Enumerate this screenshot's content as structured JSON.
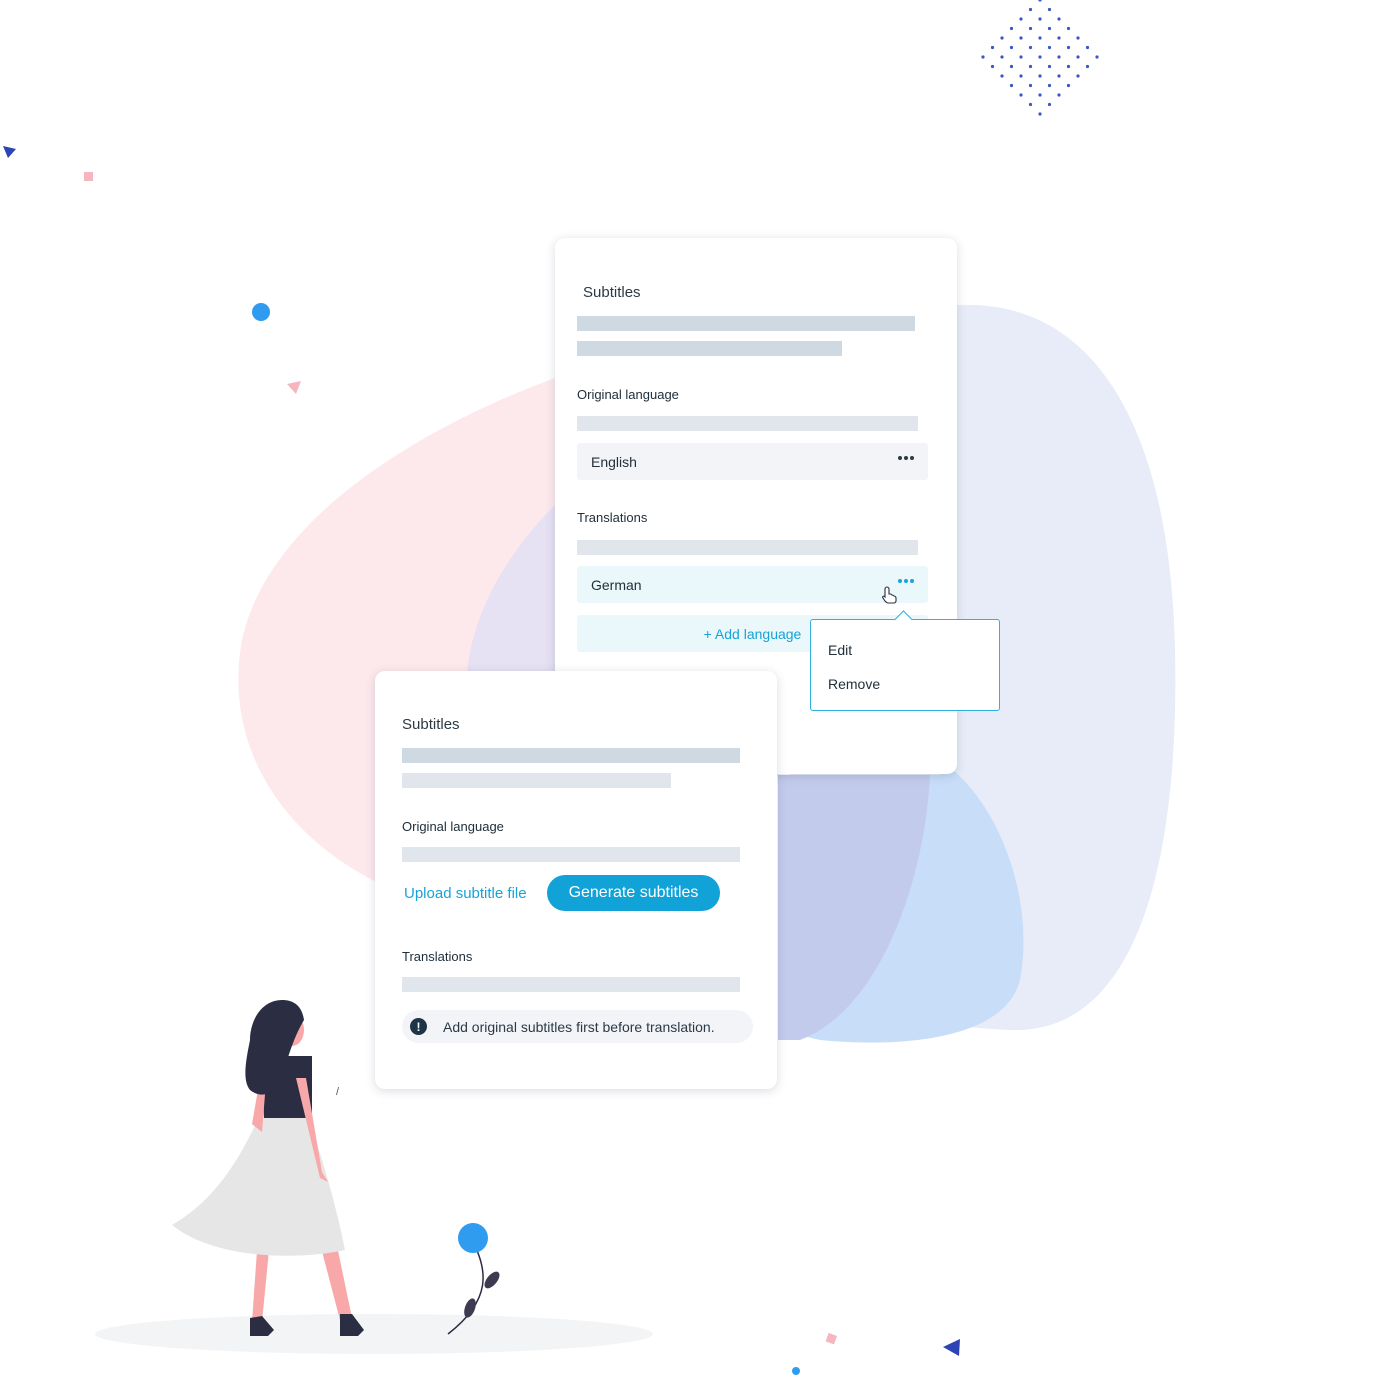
{
  "colors": {
    "accent": "#11a2d8",
    "accent_text": "#17a3d8",
    "skeleton": "#cfd9e2",
    "row_bg": "#f3f4f8",
    "selected_row_bg": "#eaf7fb",
    "decor_blue": "#2f9cf0",
    "decor_navy": "#2d44b5",
    "decor_pink": "#f5b6c0"
  },
  "back_card": {
    "title": "Subtitles",
    "original_language_label": "Original language",
    "original_language_value": "English",
    "translations_label": "Translations",
    "translation_value": "German",
    "add_language_label": "+ Add language",
    "more_icon": "more-horizontal-icon",
    "cursor_icon": "hand-pointer-icon"
  },
  "context_menu": {
    "items": [
      "Edit",
      "Remove"
    ]
  },
  "front_card": {
    "title": "Subtitles",
    "original_language_label": "Original language",
    "upload_label": "Upload subtitle file",
    "generate_label": "Generate subtitles",
    "translations_label": "Translations",
    "notice_icon": "info-exclamation-icon",
    "notice_icon_glyph": "!",
    "notice_text": "Add original subtitles first before translation."
  },
  "decor_mark": "/"
}
